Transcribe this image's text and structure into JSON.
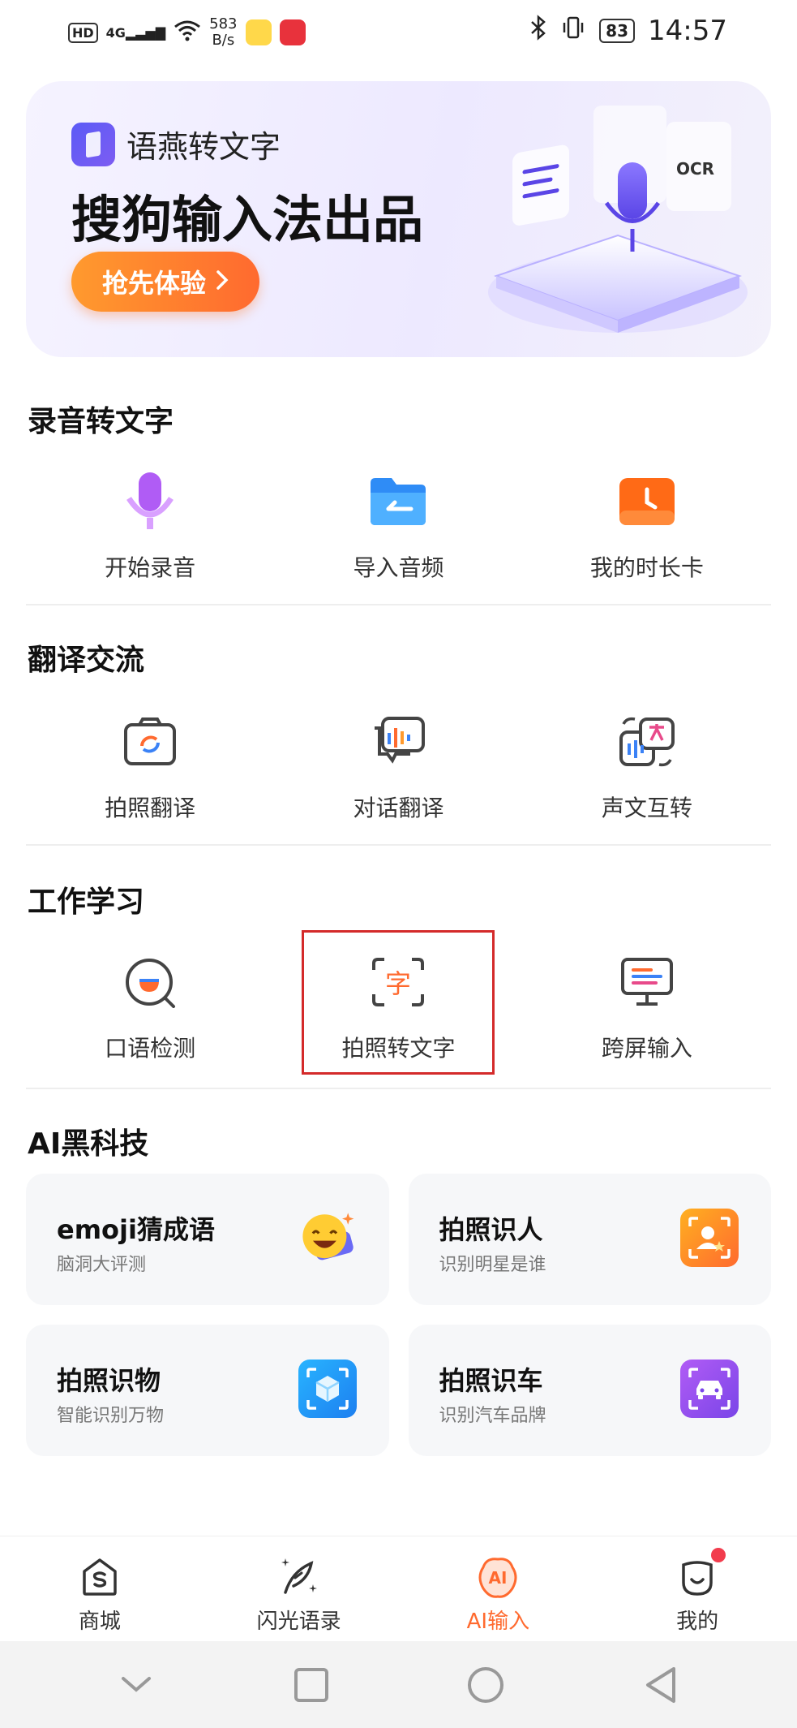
{
  "status_bar": {
    "hd": "HD",
    "network": "4G",
    "speed_value": "583",
    "speed_unit": "B/s",
    "battery": "83",
    "time": "14:57"
  },
  "banner": {
    "brand": "语燕转文字",
    "headline": "搜狗输入法出品",
    "cta": "抢先体验",
    "ocr_tag": "OCR"
  },
  "sections": {
    "recording": {
      "title": "录音转文字",
      "items": [
        {
          "label": "开始录音",
          "icon": "microphone-icon"
        },
        {
          "label": "导入音频",
          "icon": "folder-icon"
        },
        {
          "label": "我的时长卡",
          "icon": "clock-card-icon"
        }
      ]
    },
    "translation": {
      "title": "翻译交流",
      "items": [
        {
          "label": "拍照翻译",
          "icon": "camera-translate-icon"
        },
        {
          "label": "对话翻译",
          "icon": "dialog-translate-icon"
        },
        {
          "label": "声文互转",
          "icon": "voice-text-convert-icon"
        }
      ]
    },
    "work_study": {
      "title": "工作学习",
      "items": [
        {
          "label": "口语检测",
          "icon": "speech-check-icon"
        },
        {
          "label": "拍照转文字",
          "icon": "photo-to-text-icon",
          "glyph": "字"
        },
        {
          "label": "跨屏输入",
          "icon": "cross-screen-input-icon"
        }
      ]
    },
    "ai_tech": {
      "title": "AI黑科技",
      "cards": [
        {
          "title": "emoji猜成语",
          "subtitle": "脑洞大评测",
          "icon": "emoji-face-icon"
        },
        {
          "title": "拍照识人",
          "subtitle": "识别明星是谁",
          "icon": "person-scan-icon"
        },
        {
          "title": "拍照识物",
          "subtitle": "智能识别万物",
          "icon": "cube-scan-icon"
        },
        {
          "title": "拍照识车",
          "subtitle": "识别汽车品牌",
          "icon": "car-scan-icon"
        }
      ]
    }
  },
  "bottom_nav": [
    {
      "label": "商城",
      "icon": "shop-icon",
      "active": false
    },
    {
      "label": "闪光语录",
      "icon": "quill-sparkle-icon",
      "active": false
    },
    {
      "label": "AI输入",
      "icon": "ai-input-icon",
      "active": true,
      "icon_text": "AI"
    },
    {
      "label": "我的",
      "icon": "profile-icon",
      "active": false,
      "badge": true
    }
  ],
  "colors": {
    "accent": "#ff6a2f",
    "highlight_border": "#d42a2a",
    "badge": "#f23c4d"
  }
}
